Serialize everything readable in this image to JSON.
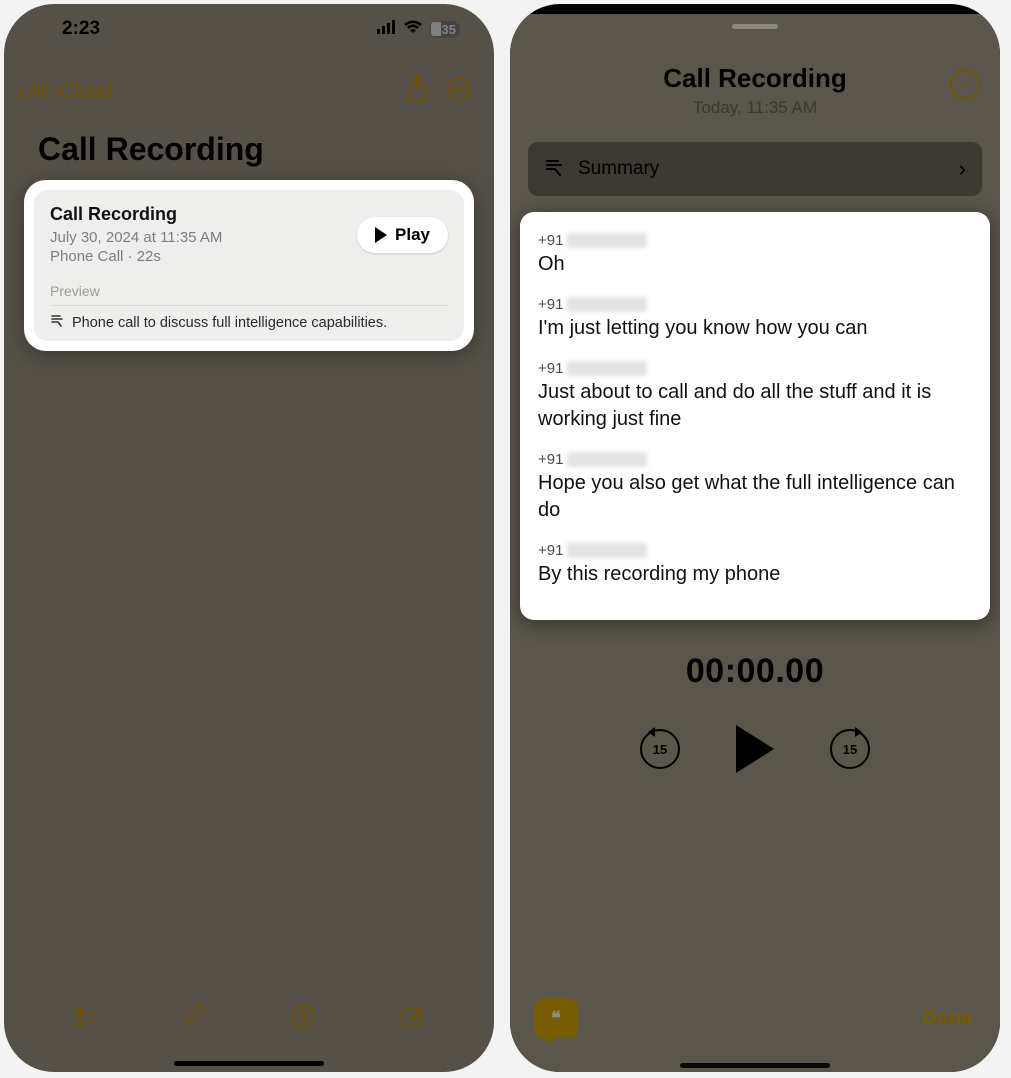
{
  "status": {
    "time": "2:23",
    "battery_pct": "35"
  },
  "left": {
    "back_label": "All iCloud",
    "note_title": "Call Recording",
    "card": {
      "title": "Call Recording",
      "datetime": "July 30, 2024 at 11:35 AM",
      "meta": "Phone Call · 22s",
      "play_label": "Play",
      "preview_label": "Preview",
      "preview_text": "Phone call to discuss full intelligence capabilities."
    }
  },
  "right": {
    "title": "Call Recording",
    "subtitle": "Today, 11:35 AM",
    "summary_label": "Summary",
    "transcript": [
      {
        "prefix": "+91",
        "text": "Oh"
      },
      {
        "prefix": "+91",
        "text": "I'm just letting you know how you can"
      },
      {
        "prefix": "+91",
        "text": "Just about to call and do all the stuff and it is working just fine"
      },
      {
        "prefix": "+91",
        "text": "Hope you also get what the full intelligence can do"
      },
      {
        "prefix": "+91",
        "text": "By this recording my phone"
      }
    ],
    "playback_time": "00:00.00",
    "skip_back": "15",
    "skip_fwd": "15",
    "done_label": "Done"
  }
}
